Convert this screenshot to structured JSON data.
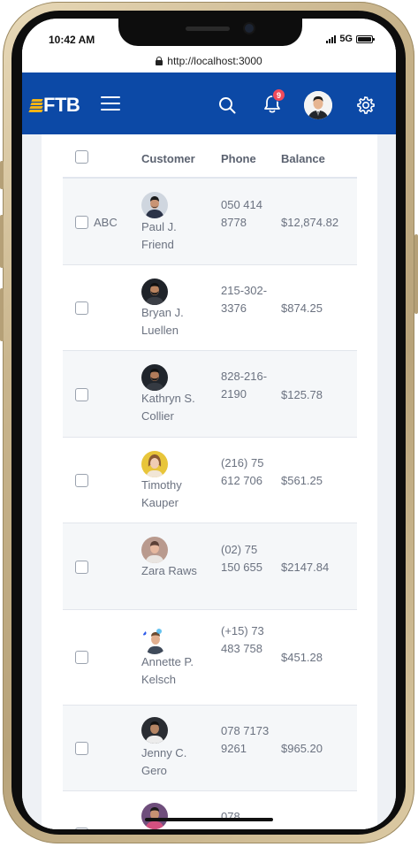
{
  "status_bar": {
    "time": "10:42 AM",
    "network": "5G"
  },
  "browser": {
    "url": "http://localhost:3000"
  },
  "header": {
    "logo_text": "FTB",
    "notification_count": "9",
    "colors": {
      "primary": "#0c49a6",
      "accent": "#f2b315",
      "badge": "#ef4a5b"
    },
    "icons": [
      "menu-icon",
      "search-icon",
      "bell-icon",
      "avatar",
      "gear-icon"
    ]
  },
  "table": {
    "columns": [
      "Customer",
      "Phone",
      "Balance"
    ],
    "rows": [
      {
        "label": "ABC",
        "name": "Paul J. Friend",
        "phone": "050 414 8778",
        "balance": "$12,874.82"
      },
      {
        "label": "",
        "name": "Bryan J. Luellen",
        "phone": "215-302-3376",
        "balance": "$874.25"
      },
      {
        "label": "",
        "name": "Kathryn S. Collier",
        "phone": "828-216-2190",
        "balance": "$125.78"
      },
      {
        "label": "",
        "name": "Timothy Kauper",
        "phone": "(216) 75 612 706",
        "balance": "$561.25"
      },
      {
        "label": "",
        "name": "Zara Raws",
        "phone": "(02) 75 150 655",
        "balance": "$2147.84"
      },
      {
        "label": "",
        "name": "Annette P. Kelsch",
        "phone": "(+15) 73 483 758",
        "balance": "$451.28"
      },
      {
        "label": "",
        "name": "Jenny C. Gero",
        "phone": "078 7173 9261",
        "balance": "$965.20"
      },
      {
        "label": "",
        "name": "",
        "phone": "078",
        "balance": ""
      }
    ]
  }
}
